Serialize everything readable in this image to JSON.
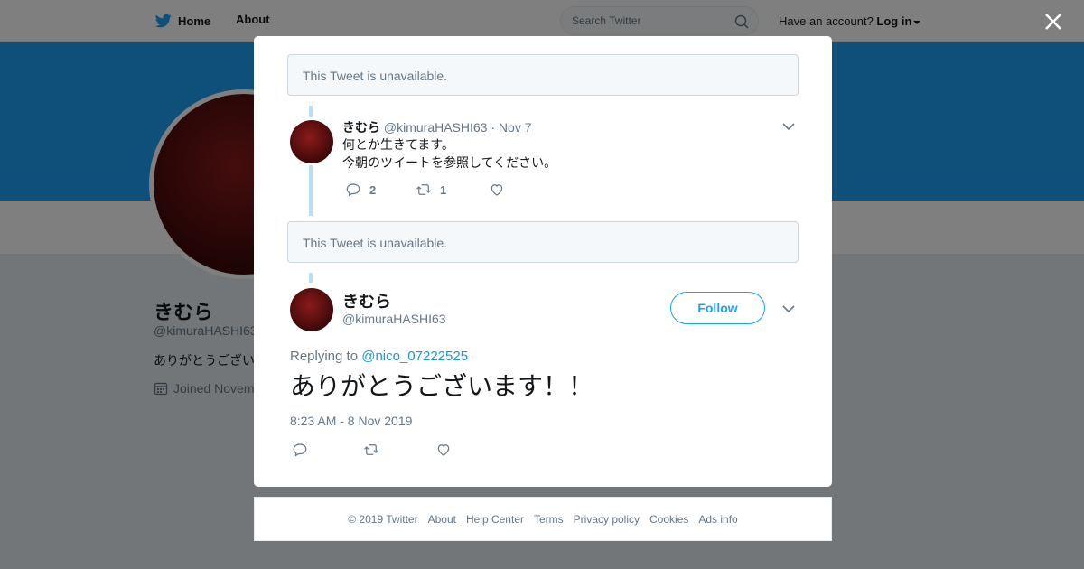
{
  "topbar": {
    "home_label": "Home",
    "about_label": "About",
    "search_placeholder": "Search Twitter",
    "account_prompt": "Have an account?",
    "login_label": "Log in"
  },
  "profile": {
    "name": "きむら",
    "handle": "@kimuraHASHI63",
    "bio_fragment": "ありがとうござい",
    "joined_fragment": "Joined Novem"
  },
  "modal": {
    "unavailable_1": "This Tweet is unavailable.",
    "unavailable_2": "This Tweet is unavailable.",
    "tweet": {
      "name": "きむら",
      "handle": "@kimuraHASHI63",
      "separator": "·",
      "date": "Nov 7",
      "lines": [
        "何とか生きてます。",
        "今朝のツイートを参照してください。"
      ],
      "reply_count": "2",
      "retweet_count": "1"
    },
    "main": {
      "name": "きむら",
      "handle": "@kimuraHASHI63",
      "follow_label": "Follow",
      "replying_prefix": "Replying to",
      "replying_to": "@nico_07222525",
      "text": "ありがとうございます！！",
      "timestamp": "8:23 AM - 8 Nov 2019"
    }
  },
  "footer": {
    "links": [
      "© 2019 Twitter",
      "About",
      "Help Center",
      "Terms",
      "Privacy policy",
      "Cookies",
      "Ads info"
    ]
  },
  "colors": {
    "accent": "#1da1f2",
    "thread_line": "#b8dff7",
    "avatar": "#5a0f0f"
  }
}
